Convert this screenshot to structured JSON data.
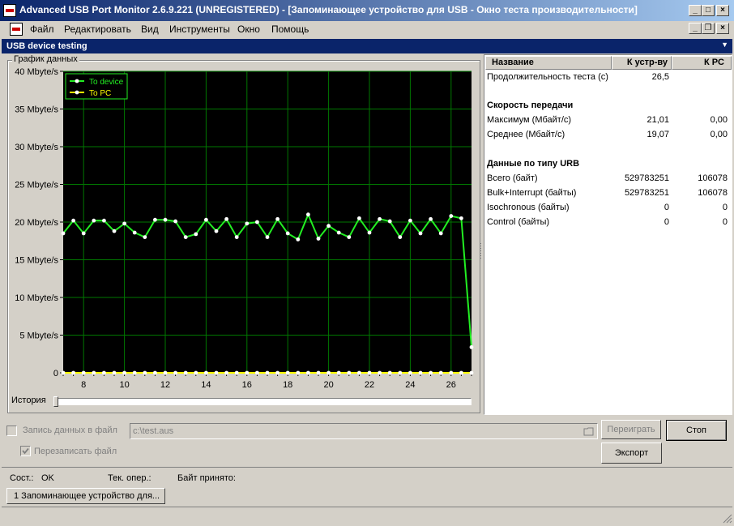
{
  "window": {
    "title": "Advanced USB Port Monitor 2.6.9.221 (UNREGISTERED) - [Запоминающее устройство для USB - Окно теста производительности]",
    "controls": [
      "_",
      "□",
      "×"
    ],
    "mdi_controls": [
      "_",
      "❐",
      "×"
    ]
  },
  "menu": [
    "Файл",
    "Редактировать",
    "Вид",
    "Инструменты",
    "Окно",
    "Помощь"
  ],
  "panel": {
    "title": "USB device testing"
  },
  "graph": {
    "group_label": "График данных",
    "history_label": "История",
    "colors": {
      "to_device": "#22ee22",
      "to_pc": "#ffff00",
      "grid": "#007700",
      "background": "#000000"
    }
  },
  "chart_data": {
    "type": "line",
    "ylabel_unit": "Mbyte/s",
    "yticks": [
      "0",
      "5 Mbyte/s",
      "10 Mbyte/s",
      "15 Mbyte/s",
      "20 Mbyte/s",
      "25 Mbyte/s",
      "30 Mbyte/s",
      "35 Mbyte/s",
      "40 Mbyte/s"
    ],
    "ylim": [
      0,
      40
    ],
    "xlim": [
      7,
      27
    ],
    "xticks": [
      8,
      10,
      12,
      14,
      16,
      18,
      20,
      22,
      24,
      26
    ],
    "grid": true,
    "legend_position": "top-left",
    "series": [
      {
        "name": "To device",
        "color": "#22ee22",
        "x": [
          7.0,
          7.5,
          8.0,
          8.5,
          9.0,
          9.5,
          10.0,
          10.5,
          11.0,
          11.5,
          12.0,
          12.5,
          13.0,
          13.5,
          14.0,
          14.5,
          15.0,
          15.5,
          16.0,
          16.5,
          17.0,
          17.5,
          18.0,
          18.5,
          19.0,
          19.5,
          20.0,
          20.5,
          21.0,
          21.5,
          22.0,
          22.5,
          23.0,
          23.5,
          24.0,
          24.5,
          25.0,
          25.5,
          26.0,
          26.5,
          27.0
        ],
        "values": [
          18.5,
          20.2,
          18.5,
          20.2,
          20.2,
          18.8,
          19.8,
          18.6,
          18.0,
          20.3,
          20.3,
          20.1,
          18.0,
          18.4,
          20.3,
          18.8,
          20.4,
          18.0,
          19.8,
          20.0,
          18.0,
          20.4,
          18.5,
          17.7,
          21.0,
          17.8,
          19.5,
          18.6,
          18.0,
          20.5,
          18.6,
          20.4,
          20.1,
          18.0,
          20.2,
          18.5,
          20.4,
          18.5,
          20.8,
          20.5,
          3.4
        ]
      },
      {
        "name": "To PC",
        "color": "#ffff00",
        "x": [
          7.0,
          7.5,
          8.0,
          8.5,
          9.0,
          9.5,
          10.0,
          10.5,
          11.0,
          11.5,
          12.0,
          12.5,
          13.0,
          13.5,
          14.0,
          14.5,
          15.0,
          15.5,
          16.0,
          16.5,
          17.0,
          17.5,
          18.0,
          18.5,
          19.0,
          19.5,
          20.0,
          20.5,
          21.0,
          21.5,
          22.0,
          22.5,
          23.0,
          23.5,
          24.0,
          24.5,
          25.0,
          25.5,
          26.0,
          26.5,
          27.0
        ],
        "values": [
          0,
          0,
          0,
          0,
          0,
          0,
          0,
          0,
          0,
          0,
          0,
          0,
          0,
          0,
          0,
          0,
          0,
          0,
          0,
          0,
          0,
          0,
          0,
          0,
          0,
          0,
          0,
          0,
          0,
          0,
          0,
          0,
          0,
          0,
          0,
          0,
          0,
          0,
          0,
          0,
          0
        ]
      }
    ]
  },
  "stats": {
    "columns": [
      "Название",
      "К устр-ву",
      "К PC"
    ],
    "rows": [
      {
        "type": "row",
        "name": "Продолжительность теста (с)",
        "dev": "26,5",
        "pc": ""
      },
      {
        "type": "section",
        "name": "Скорость передачи"
      },
      {
        "type": "row",
        "name": "Максимум (Мбайт/с)",
        "dev": "21,01",
        "pc": "0,00"
      },
      {
        "type": "row",
        "name": "Среднее (Мбайт/с)",
        "dev": "19,07",
        "pc": "0,00"
      },
      {
        "type": "section",
        "name": "Данные по типу URB"
      },
      {
        "type": "row",
        "name": "Всего (байт)",
        "dev": "529783251",
        "pc": "106078"
      },
      {
        "type": "row",
        "name": "Bulk+Interrupt (байты)",
        "dev": "529783251",
        "pc": "106078"
      },
      {
        "type": "row",
        "name": "Isochronous (байты)",
        "dev": "0",
        "pc": "0"
      },
      {
        "type": "row",
        "name": "Control (байты)",
        "dev": "0",
        "pc": "0"
      }
    ]
  },
  "controls": {
    "record_label": "Запись данных в файл",
    "record_checked": false,
    "file_path": "c:\\test.aus",
    "overwrite_label": "Перезаписать файл",
    "overwrite_checked": true,
    "replay_button": "Переиграть",
    "stop_button": "Стоп",
    "export_button": "Экспорт"
  },
  "status": {
    "state_label": "Сост.:",
    "state_value": "OK",
    "current_op_label": "Тек. опер.:",
    "current_op_value": "",
    "bytes_received_label": "Байт принято:",
    "bytes_received_value": ""
  },
  "taskbar": {
    "item": "1 Запоминающее устройство для..."
  }
}
